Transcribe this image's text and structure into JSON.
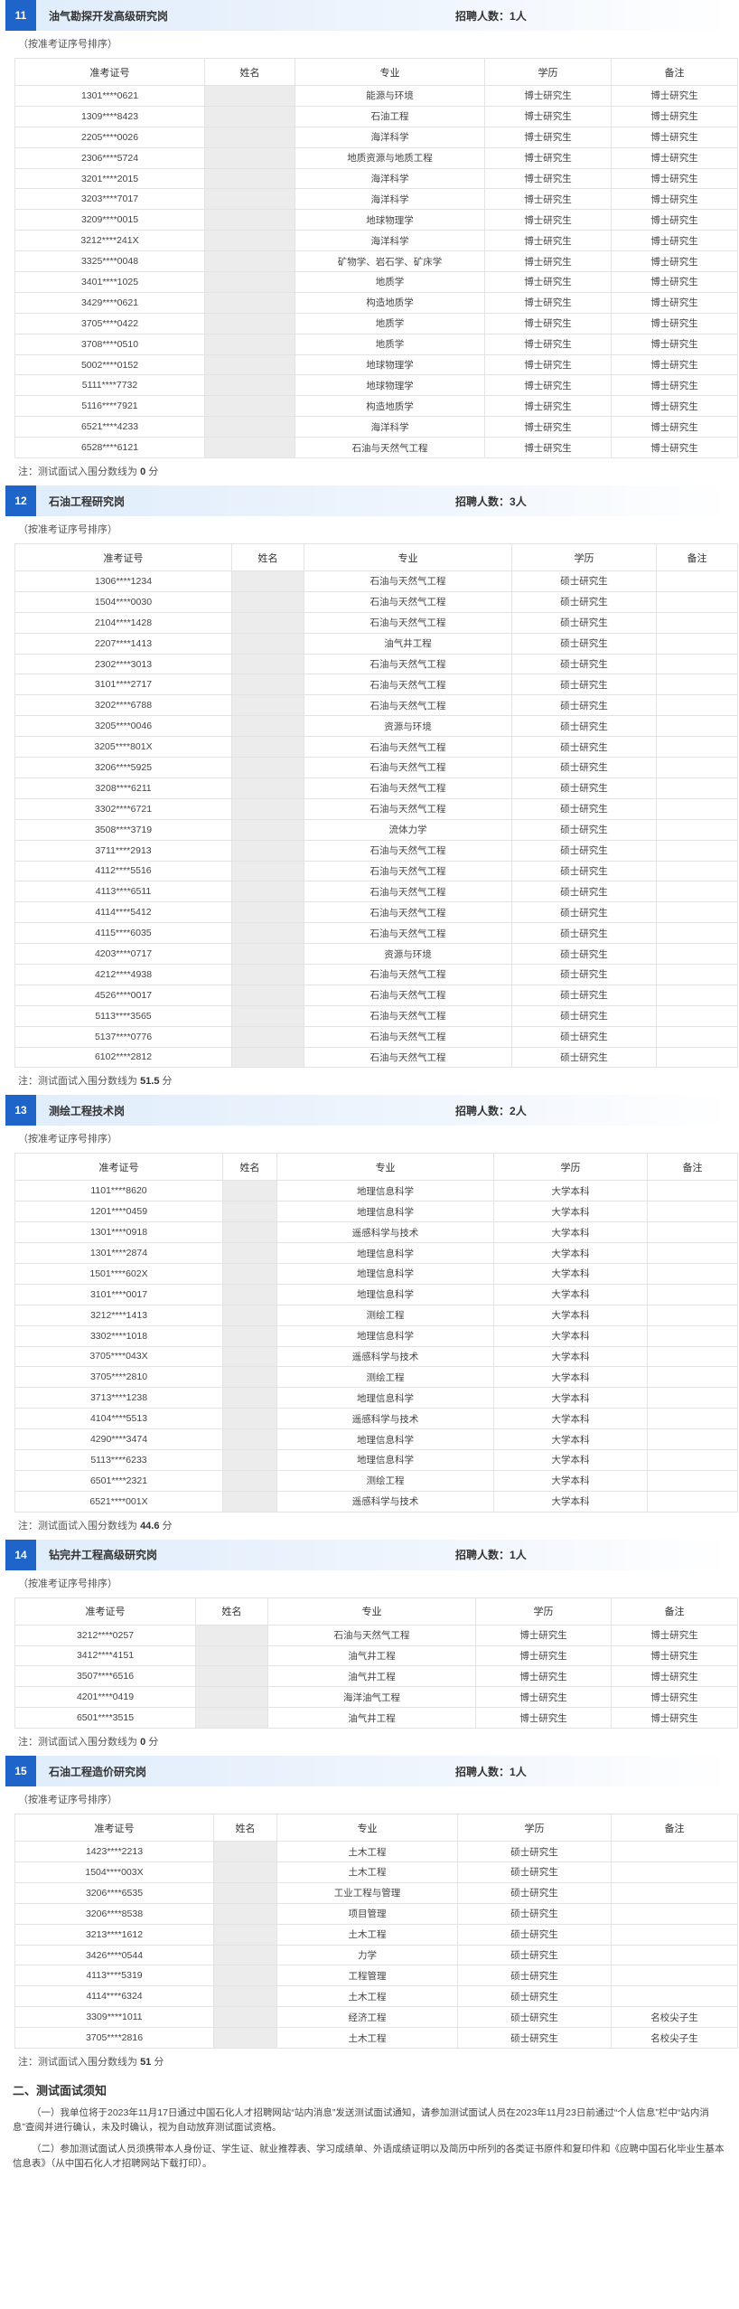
{
  "headers": [
    "准考证号",
    "姓名",
    "专业",
    "学历",
    "备注"
  ],
  "sort_note": "（按准考证序号排序）",
  "count_label": "招聘人数：",
  "cutoff_label": "注：测试面试入围分数线为",
  "cutoff_unit": "分",
  "sections": [
    {
      "num": "11",
      "title": "油气勘探开发高级研究岗",
      "count": "1人",
      "cutoff": "0",
      "rows": [
        [
          "1301****0621",
          "",
          "能源与环境",
          "博士研究生",
          "博士研究生"
        ],
        [
          "1309****8423",
          "",
          "石油工程",
          "博士研究生",
          "博士研究生"
        ],
        [
          "2205****0026",
          "",
          "海洋科学",
          "博士研究生",
          "博士研究生"
        ],
        [
          "2306****5724",
          "",
          "地质资源与地质工程",
          "博士研究生",
          "博士研究生"
        ],
        [
          "3201****2015",
          "",
          "海洋科学",
          "博士研究生",
          "博士研究生"
        ],
        [
          "3203****7017",
          "",
          "海洋科学",
          "博士研究生",
          "博士研究生"
        ],
        [
          "3209****0015",
          "",
          "地球物理学",
          "博士研究生",
          "博士研究生"
        ],
        [
          "3212****241X",
          "",
          "海洋科学",
          "博士研究生",
          "博士研究生"
        ],
        [
          "3325****0048",
          "",
          "矿物学、岩石学、矿床学",
          "博士研究生",
          "博士研究生"
        ],
        [
          "3401****1025",
          "",
          "地质学",
          "博士研究生",
          "博士研究生"
        ],
        [
          "3429****0621",
          "",
          "构造地质学",
          "博士研究生",
          "博士研究生"
        ],
        [
          "3705****0422",
          "",
          "地质学",
          "博士研究生",
          "博士研究生"
        ],
        [
          "3708****0510",
          "",
          "地质学",
          "博士研究生",
          "博士研究生"
        ],
        [
          "5002****0152",
          "",
          "地球物理学",
          "博士研究生",
          "博士研究生"
        ],
        [
          "5111****7732",
          "",
          "地球物理学",
          "博士研究生",
          "博士研究生"
        ],
        [
          "5116****7921",
          "",
          "构造地质学",
          "博士研究生",
          "博士研究生"
        ],
        [
          "6521****4233",
          "",
          "海洋科学",
          "博士研究生",
          "博士研究生"
        ],
        [
          "6528****6121",
          "",
          "石油与天然气工程",
          "博士研究生",
          "博士研究生"
        ]
      ]
    },
    {
      "num": "12",
      "title": "石油工程研究岗",
      "count": "3人",
      "cutoff": "51.5",
      "rows": [
        [
          "1306****1234",
          "",
          "石油与天然气工程",
          "硕士研究生",
          ""
        ],
        [
          "1504****0030",
          "",
          "石油与天然气工程",
          "硕士研究生",
          ""
        ],
        [
          "2104****1428",
          "",
          "石油与天然气工程",
          "硕士研究生",
          ""
        ],
        [
          "2207****1413",
          "",
          "油气井工程",
          "硕士研究生",
          ""
        ],
        [
          "2302****3013",
          "",
          "石油与天然气工程",
          "硕士研究生",
          ""
        ],
        [
          "3101****2717",
          "",
          "石油与天然气工程",
          "硕士研究生",
          ""
        ],
        [
          "3202****6788",
          "",
          "石油与天然气工程",
          "硕士研究生",
          ""
        ],
        [
          "3205****0046",
          "",
          "资源与环境",
          "硕士研究生",
          ""
        ],
        [
          "3205****801X",
          "",
          "石油与天然气工程",
          "硕士研究生",
          ""
        ],
        [
          "3206****5925",
          "",
          "石油与天然气工程",
          "硕士研究生",
          ""
        ],
        [
          "3208****6211",
          "",
          "石油与天然气工程",
          "硕士研究生",
          ""
        ],
        [
          "3302****6721",
          "",
          "石油与天然气工程",
          "硕士研究生",
          ""
        ],
        [
          "3508****3719",
          "",
          "流体力学",
          "硕士研究生",
          ""
        ],
        [
          "3711****2913",
          "",
          "石油与天然气工程",
          "硕士研究生",
          ""
        ],
        [
          "4112****5516",
          "",
          "石油与天然气工程",
          "硕士研究生",
          ""
        ],
        [
          "4113****6511",
          "",
          "石油与天然气工程",
          "硕士研究生",
          ""
        ],
        [
          "4114****5412",
          "",
          "石油与天然气工程",
          "硕士研究生",
          ""
        ],
        [
          "4115****6035",
          "",
          "石油与天然气工程",
          "硕士研究生",
          ""
        ],
        [
          "4203****0717",
          "",
          "资源与环境",
          "硕士研究生",
          ""
        ],
        [
          "4212****4938",
          "",
          "石油与天然气工程",
          "硕士研究生",
          ""
        ],
        [
          "4526****0017",
          "",
          "石油与天然气工程",
          "硕士研究生",
          ""
        ],
        [
          "5113****3565",
          "",
          "石油与天然气工程",
          "硕士研究生",
          ""
        ],
        [
          "5137****0776",
          "",
          "石油与天然气工程",
          "硕士研究生",
          ""
        ],
        [
          "6102****2812",
          "",
          "石油与天然气工程",
          "硕士研究生",
          ""
        ]
      ]
    },
    {
      "num": "13",
      "title": "测绘工程技术岗",
      "count": "2人",
      "cutoff": "44.6",
      "rows": [
        [
          "1101****8620",
          "",
          "地理信息科学",
          "大学本科",
          ""
        ],
        [
          "1201****0459",
          "",
          "地理信息科学",
          "大学本科",
          ""
        ],
        [
          "1301****0918",
          "",
          "遥感科学与技术",
          "大学本科",
          ""
        ],
        [
          "1301****2874",
          "",
          "地理信息科学",
          "大学本科",
          ""
        ],
        [
          "1501****602X",
          "",
          "地理信息科学",
          "大学本科",
          ""
        ],
        [
          "3101****0017",
          "",
          "地理信息科学",
          "大学本科",
          ""
        ],
        [
          "3212****1413",
          "",
          "测绘工程",
          "大学本科",
          ""
        ],
        [
          "3302****1018",
          "",
          "地理信息科学",
          "大学本科",
          ""
        ],
        [
          "3705****043X",
          "",
          "遥感科学与技术",
          "大学本科",
          ""
        ],
        [
          "3705****2810",
          "",
          "测绘工程",
          "大学本科",
          ""
        ],
        [
          "3713****1238",
          "",
          "地理信息科学",
          "大学本科",
          ""
        ],
        [
          "4104****5513",
          "",
          "遥感科学与技术",
          "大学本科",
          ""
        ],
        [
          "4290****3474",
          "",
          "地理信息科学",
          "大学本科",
          ""
        ],
        [
          "5113****6233",
          "",
          "地理信息科学",
          "大学本科",
          ""
        ],
        [
          "6501****2321",
          "",
          "测绘工程",
          "大学本科",
          ""
        ],
        [
          "6521****001X",
          "",
          "遥感科学与技术",
          "大学本科",
          ""
        ]
      ]
    },
    {
      "num": "14",
      "title": "钻完井工程高级研究岗",
      "count": "1人",
      "cutoff": "0",
      "rows": [
        [
          "3212****0257",
          "",
          "石油与天然气工程",
          "博士研究生",
          "博士研究生"
        ],
        [
          "3412****4151",
          "",
          "油气井工程",
          "博士研究生",
          "博士研究生"
        ],
        [
          "3507****6516",
          "",
          "油气井工程",
          "博士研究生",
          "博士研究生"
        ],
        [
          "4201****0419",
          "",
          "海洋油气工程",
          "博士研究生",
          "博士研究生"
        ],
        [
          "6501****3515",
          "",
          "油气井工程",
          "博士研究生",
          "博士研究生"
        ]
      ]
    },
    {
      "num": "15",
      "title": "石油工程造价研究岗",
      "count": "1人",
      "cutoff": "51",
      "rows": [
        [
          "1423****2213",
          "",
          "土木工程",
          "硕士研究生",
          ""
        ],
        [
          "1504****003X",
          "",
          "土木工程",
          "硕士研究生",
          ""
        ],
        [
          "3206****6535",
          "",
          "工业工程与管理",
          "硕士研究生",
          ""
        ],
        [
          "3206****8538",
          "",
          "项目管理",
          "硕士研究生",
          ""
        ],
        [
          "3213****1612",
          "",
          "土木工程",
          "硕士研究生",
          ""
        ],
        [
          "3426****0544",
          "",
          "力学",
          "硕士研究生",
          ""
        ],
        [
          "4113****5319",
          "",
          "工程管理",
          "硕士研究生",
          ""
        ],
        [
          "4114****6324",
          "",
          "土木工程",
          "硕士研究生",
          ""
        ],
        [
          "3309****1011",
          "",
          "经济工程",
          "硕士研究生",
          "名校尖子生"
        ],
        [
          "3705****2816",
          "",
          "土木工程",
          "硕士研究生",
          "名校尖子生"
        ]
      ]
    }
  ],
  "notice": {
    "title": "二、测试面试须知",
    "p1": "（一）我单位将于2023年11月17日通过中国石化人才招聘网站“站内消息”发送测试面试通知，请参加测试面试人员在2023年11月23日前通过“个人信息”栏中“站内消息”查阅并进行确认，未及时确认，视为自动放弃测试面试资格。",
    "p2": "（二）参加测试面试人员须携带本人身份证、学生证、就业推荐表、学习成绩单、外语成绩证明以及简历中所列的各类证书原件和复印件和《应聘中国石化毕业生基本信息表》（从中国石化人才招聘网站下载打印）。"
  }
}
